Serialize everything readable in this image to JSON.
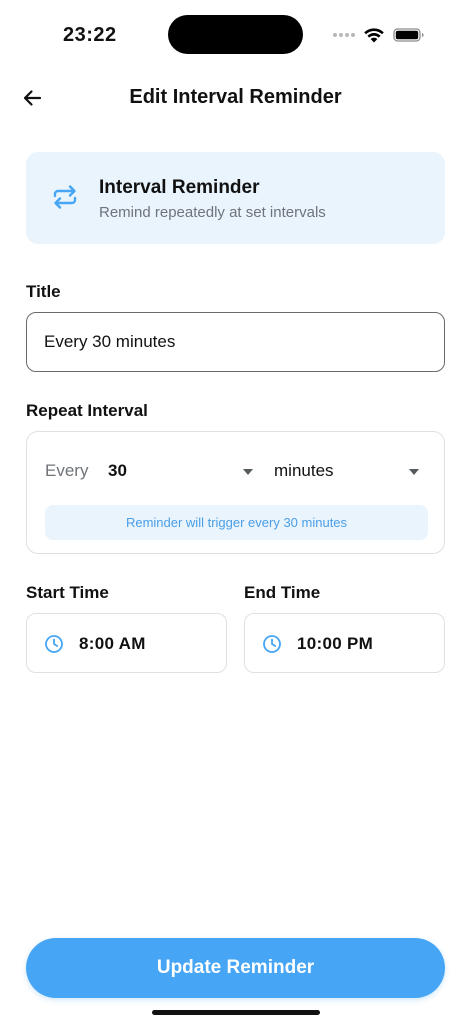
{
  "status_bar": {
    "time": "23:22"
  },
  "header": {
    "title": "Edit Interval Reminder"
  },
  "info_card": {
    "icon": "repeat-icon",
    "title": "Interval Reminder",
    "subtitle": "Remind repeatedly at set intervals"
  },
  "title_section": {
    "label": "Title",
    "value": "Every 30 minutes"
  },
  "interval_section": {
    "label": "Repeat Interval",
    "every_label": "Every",
    "amount": "30",
    "unit": "minutes",
    "note": "Reminder will trigger every 30 minutes"
  },
  "start_time": {
    "label": "Start Time",
    "value": "8:00 AM",
    "icon": "clock-icon"
  },
  "end_time": {
    "label": "End Time",
    "value": "10:00 PM",
    "icon": "clock-icon"
  },
  "actions": {
    "update_label": "Update Reminder"
  },
  "colors": {
    "accent": "#46a6f5",
    "card_background": "#e9f4fd",
    "note_text": "#4a9ee6"
  }
}
